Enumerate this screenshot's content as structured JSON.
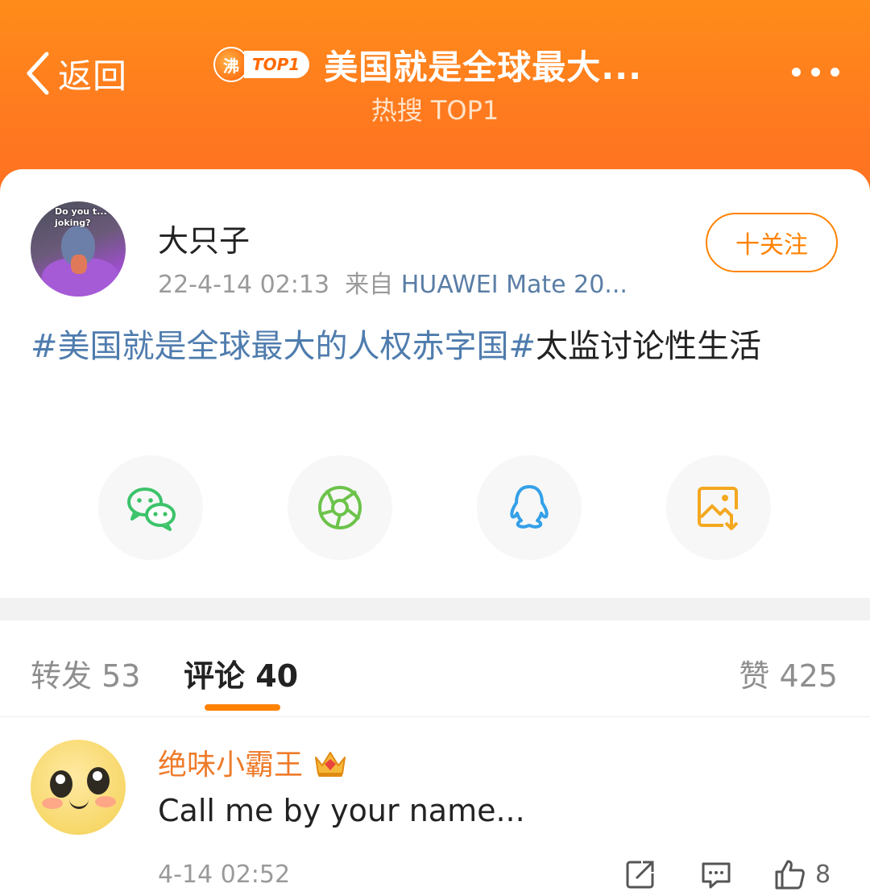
{
  "header": {
    "back_label": "返回",
    "badge_fire": "沸",
    "badge_top": "TOP1",
    "title": "美国就是全球最大...",
    "subtitle": "热搜 TOP1"
  },
  "post": {
    "username": "大只子",
    "avatar_caption": "Do you t... I'm joking?",
    "time": "22-4-14 02:13",
    "from_label": "来自",
    "device": "HUAWEI Mate 20...",
    "follow_label": "十关注",
    "topic": "#美国就是全球最大的人权赤字国#",
    "text": "太监讨论性生活"
  },
  "share": [
    {
      "name": "wechat",
      "icon": "wechat-icon",
      "color": "#3cc36b"
    },
    {
      "name": "moments",
      "icon": "moments-icon",
      "color": "#6cc34a"
    },
    {
      "name": "qq",
      "icon": "qq-icon",
      "color": "#34a0e8"
    },
    {
      "name": "save-image",
      "icon": "save-image-icon",
      "color": "#f4a81f"
    }
  ],
  "tabs": {
    "repost": "转发 53",
    "comments": "评论 40",
    "likes": "赞 425"
  },
  "comment": {
    "username": "绝味小霸王",
    "text": "Call me by your name...",
    "time": "4-14 02:52",
    "like_count": "8"
  },
  "colors": {
    "accent": "#ff8200",
    "topic": "#4f7cae",
    "header": "#ff7a1f"
  }
}
